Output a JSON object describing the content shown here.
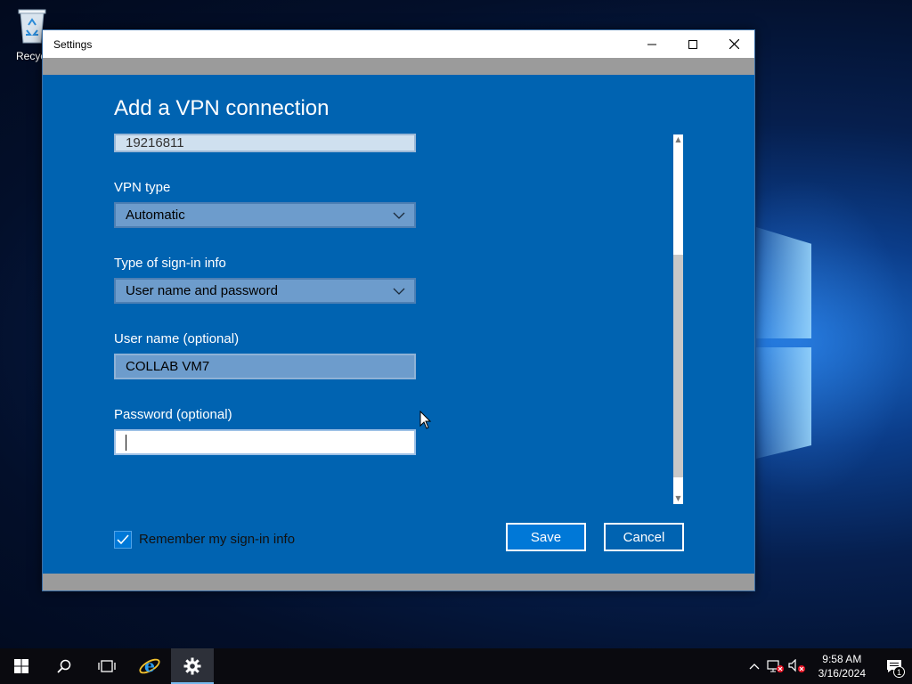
{
  "desktop": {
    "recycle_bin_label": "Recycl"
  },
  "window": {
    "title": "Settings",
    "minimize_glyph": "—",
    "maximize_glyph": "☐",
    "close_glyph": "✕"
  },
  "vpn": {
    "heading": "Add a VPN connection",
    "server_value": "19216811",
    "vpn_type_label": "VPN type",
    "vpn_type_value": "Automatic",
    "signin_type_label": "Type of sign-in info",
    "signin_type_value": "User name and password",
    "username_label": "User name (optional)",
    "username_value": "COLLAB VM7",
    "password_label": "Password (optional)",
    "password_value": "",
    "remember_label": "Remember my sign-in info",
    "remember_checked": true,
    "save_label": "Save",
    "cancel_label": "Cancel"
  },
  "taskbar": {
    "time": "9:58 AM",
    "date": "3/16/2024",
    "notification_count": "1"
  },
  "colors": {
    "content_bg": "#0063b1",
    "accent": "#0078d7",
    "taskbar_bg": "#0a0a0f"
  }
}
